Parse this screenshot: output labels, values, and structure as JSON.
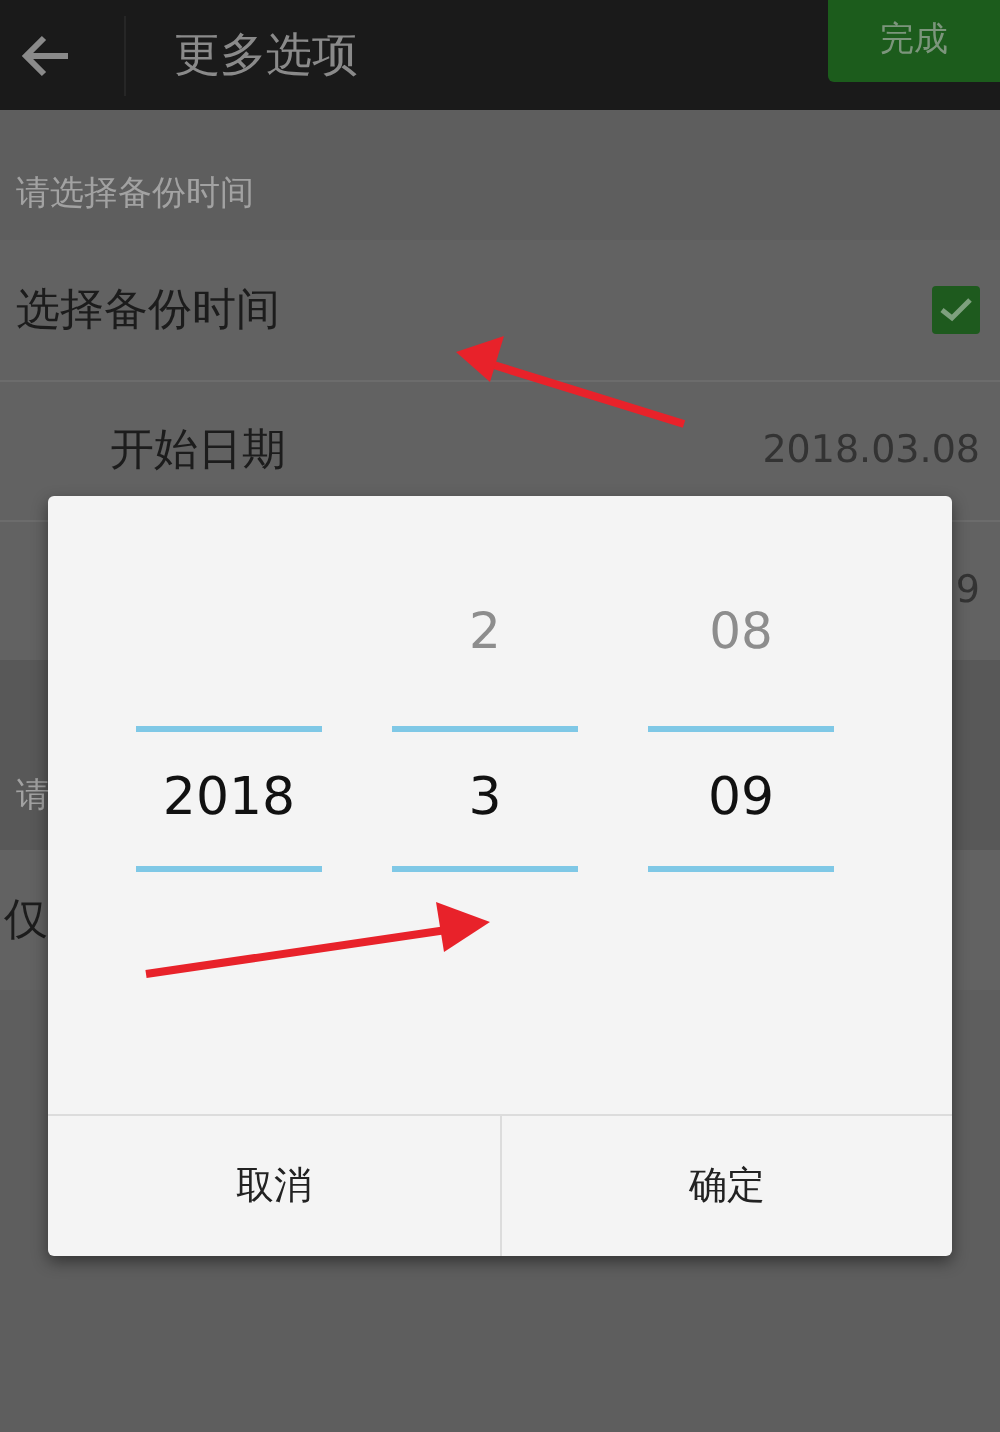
{
  "top_bar": {
    "title": "更多选项",
    "done_button": "完成"
  },
  "sections": [
    {
      "header": "请选择备份时间",
      "rows": [
        {
          "kind": "toggle",
          "label": "选择备份时间",
          "checked": true
        },
        {
          "kind": "date",
          "label": "开始日期",
          "value": "2018.03.08"
        },
        {
          "kind": "date",
          "value": "9"
        }
      ]
    },
    {
      "header": "请",
      "rows": [
        {
          "kind": "toggle",
          "label": "仅"
        }
      ]
    }
  ],
  "dialog": {
    "columns": [
      {
        "selected": "2018"
      },
      {
        "above": "2",
        "selected": "3"
      },
      {
        "above": "08",
        "selected": "09"
      }
    ],
    "buttons": [
      "取消",
      "确定"
    ]
  }
}
